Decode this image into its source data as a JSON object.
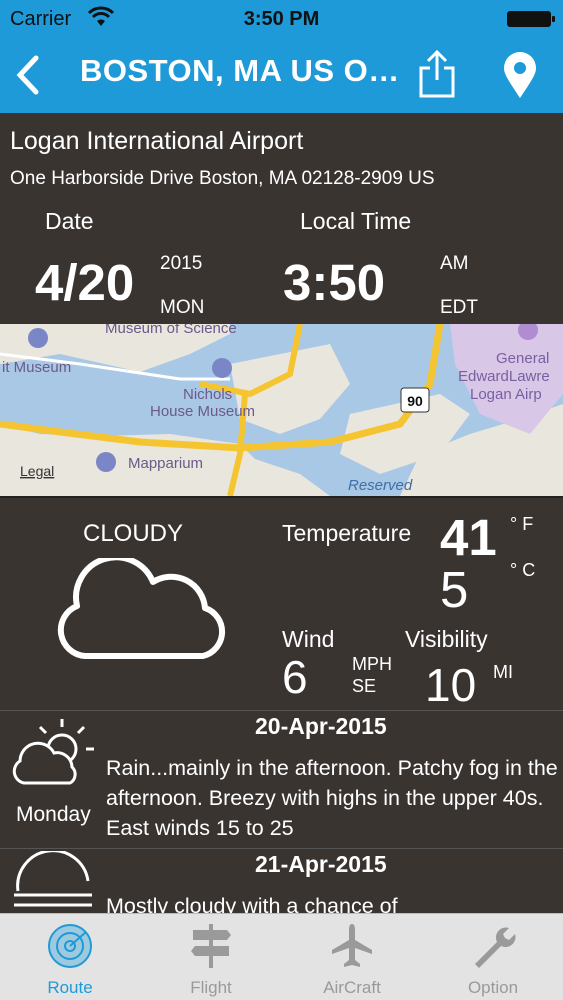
{
  "status_bar": {
    "carrier": "Carrier",
    "time": "3:50 PM"
  },
  "nav": {
    "title": "BOSTON, MA US O…"
  },
  "location": {
    "name": "Logan International Airport",
    "address": "One Harborside Drive Boston, MA 02128-2909 US"
  },
  "datetime": {
    "date_label": "Date",
    "date": "4/20",
    "year": "2015",
    "weekday": "MON",
    "time_label": "Local Time",
    "time": "3:50",
    "ampm": "AM",
    "timezone": "EDT"
  },
  "map": {
    "labels": {
      "museum_science": "Museum of Science",
      "it_museum": "it Museum",
      "nichols_1": "Nichols",
      "nichols_2": "House Museum",
      "mapparium": "Mapparium",
      "legal": "Legal",
      "reserved": "Reserved",
      "highway": "90",
      "airport_1": "General",
      "airport_2": "EdwardLawre",
      "airport_3": "Logan Airp"
    }
  },
  "weather": {
    "condition": "CLOUDY",
    "temperature_label": "Temperature",
    "temp_f": "41",
    "unit_f": "° F",
    "temp_c": "5",
    "unit_c": "° C",
    "wind_label": "Wind",
    "wind_speed": "6",
    "wind_unit": "MPH",
    "wind_dir": "SE",
    "visibility_label": "Visibility",
    "visibility": "10",
    "visibility_unit": "MI"
  },
  "forecast": [
    {
      "date": "20-Apr-2015",
      "day": "Monday",
      "text": "Rain...mainly in the afternoon. Patchy fog in the afternoon. Breezy with highs in the upper 40s. East winds 15 to 25"
    },
    {
      "date": "21-Apr-2015",
      "day": "",
      "text": "Mostly cloudy with a chance of"
    }
  ],
  "tabs": [
    {
      "label": "Route",
      "icon": "radar-icon",
      "active": true
    },
    {
      "label": "Flight",
      "icon": "signpost-icon",
      "active": false
    },
    {
      "label": "AirCraft",
      "icon": "airplane-icon",
      "active": false
    },
    {
      "label": "Option",
      "icon": "wrench-icon",
      "active": false
    }
  ],
  "colors": {
    "header": "#1e9ad8",
    "panel": "#3a3431",
    "tab_active": "#1e9ad8",
    "tab_inactive": "#9a9a9a"
  }
}
